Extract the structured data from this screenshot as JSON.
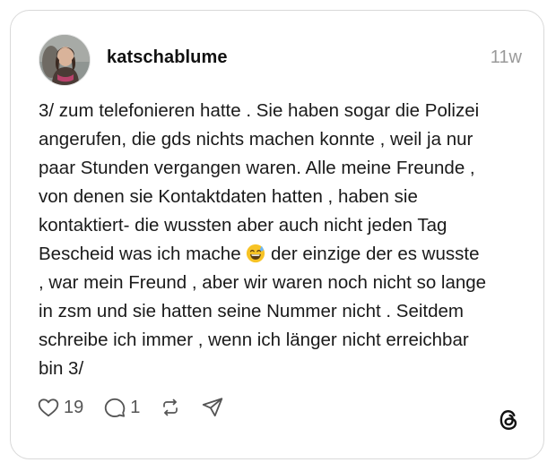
{
  "post": {
    "username": "katschablume",
    "time": "11w",
    "text_lines": [
      "3/ zum telefonieren hatte . Sie haben sogar die Polizei",
      "angerufen, die gds nichts machen konnte , weil ja nur",
      "paar Stunden vergangen waren. Alle meine Freunde ,",
      "von denen sie Kontaktdaten hatten , haben sie",
      "kontaktiert- die wussten aber auch nicht jeden Tag",
      "Bescheid was ich mache",
      " der einzige der es wusste",
      ", war mein Freund , aber wir waren noch nicht so lange",
      "in zsm und sie hatten seine Nummer nicht . Seitdem",
      "schreibe ich immer , wenn ich länger nicht erreichbar",
      "bin 3/"
    ],
    "emoji": "grinning-face-with-sweat"
  },
  "actions": {
    "likes": "19",
    "replies": "1"
  },
  "icons": {
    "like": "heart-icon",
    "reply": "comment-icon",
    "repost": "repost-icon",
    "share": "send-icon",
    "brand": "threads-logo-icon"
  }
}
